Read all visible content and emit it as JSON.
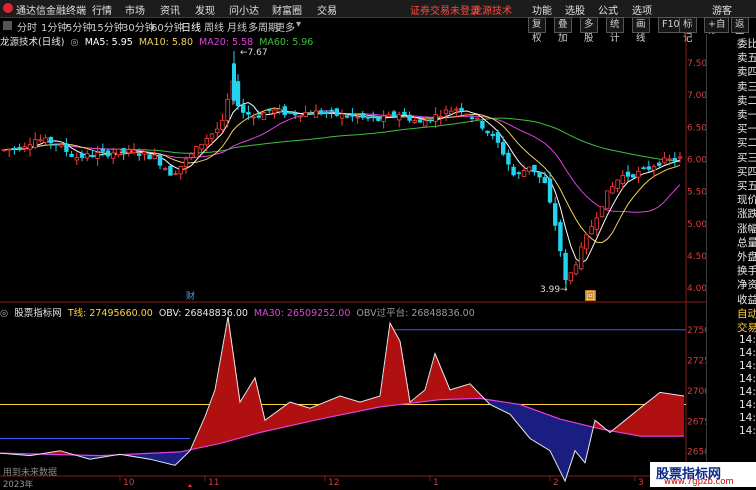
{
  "app": {
    "name": "通达信金融终端",
    "menu": [
      "行情",
      "市场",
      "资讯",
      "发现",
      "问小达",
      "财富圈",
      "交易"
    ],
    "warning": "证券交易未登录",
    "brand": "龙源技术",
    "right_menu": [
      "功能",
      "选股",
      "公式",
      "选项"
    ],
    "user": "游客"
  },
  "periods": [
    "分时",
    "1分钟",
    "5分钟",
    "15分钟",
    "30分钟",
    "60分钟",
    "日线",
    "周线",
    "月线",
    "多周期",
    "更多"
  ],
  "active_period": "日线",
  "toolbar": [
    "复权",
    "叠加",
    "多股",
    "统计",
    "画线",
    "F10",
    "标记",
    "+自选",
    "返回"
  ],
  "main_legend": {
    "title": "龙源技术(日线)",
    "ma5": "MA5: 5.95",
    "ma10": "MA10: 5.80",
    "ma20": "MA20: 5.58",
    "ma60": "MA60: 5.96"
  },
  "sub_legend": {
    "title": "股票指标网",
    "t_line": "T线: 27495660.00",
    "obv": "OBV: 26848836.00",
    "ma30": "MA30: 26509252.00",
    "obv_flat": "OBV过平台: 26848836.00"
  },
  "annotations": {
    "high": "7.67",
    "low": "3.99",
    "cai": "财",
    "hui": "回",
    "bottom_note": "用到未来数据",
    "year": "2023年"
  },
  "price_axis": [
    "7.50",
    "7.00",
    "6.50",
    "6.00",
    "5.50",
    "5.00",
    "4.50",
    "4.00"
  ],
  "sub_axis": [
    "27500",
    "27250",
    "27000",
    "26750",
    "26500"
  ],
  "x_axis": [
    "10",
    "11",
    "12",
    "1",
    "2",
    "3"
  ],
  "right_panel": {
    "labels": [
      "委比",
      "卖五",
      "卖四",
      "卖三",
      "卖二",
      "卖一",
      "买一",
      "买二",
      "买三",
      "买四",
      "买五",
      "现价",
      "涨跌",
      "涨幅",
      "总量",
      "外盘",
      "换手",
      "净资",
      "收益",
      "自动",
      "交易"
    ],
    "times": [
      "14:5",
      "14:5",
      "14:5",
      "14:5",
      "14:5",
      "14:5",
      "14:5",
      "14:5"
    ]
  },
  "watermark": {
    "title": "股票指标网",
    "url": "www.7gpzb.com"
  },
  "colors": {
    "up": "#ff3b3b",
    "down": "#22d3ee",
    "ma5": "#ffffff",
    "ma10": "#f0d060",
    "ma20": "#e040e0",
    "ma60": "#3fbf3f",
    "fill_up": "#b01010",
    "fill_down": "#1a1e80",
    "t_line": "#ffd23a"
  },
  "price_range": [
    3.8,
    7.75
  ]
}
